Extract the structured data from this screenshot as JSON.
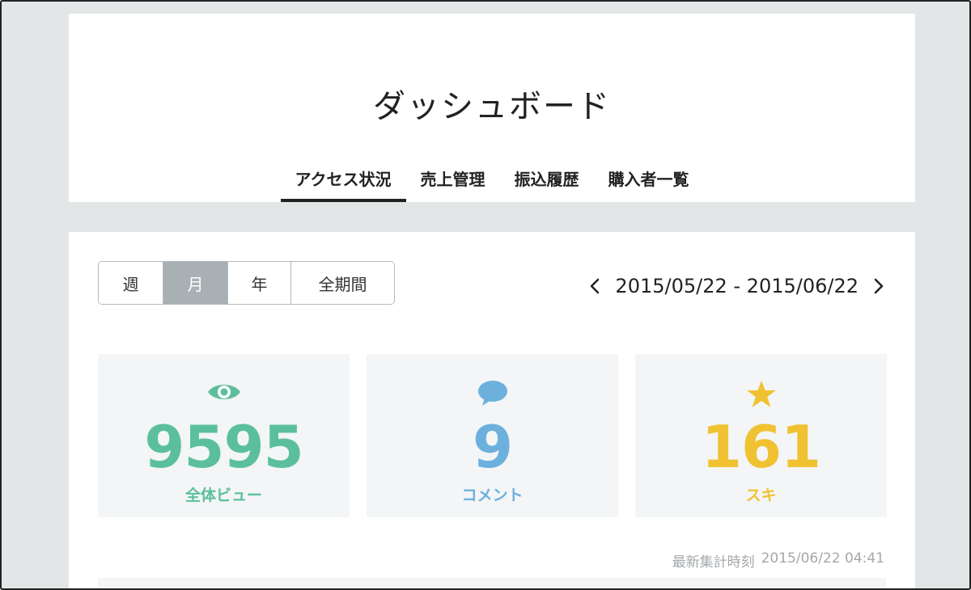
{
  "header": {
    "title": "ダッシュボード",
    "tabs": [
      {
        "label": "アクセス状況",
        "active": true
      },
      {
        "label": "売上管理",
        "active": false
      },
      {
        "label": "振込履歴",
        "active": false
      },
      {
        "label": "購入者一覧",
        "active": false
      }
    ]
  },
  "period": {
    "options": [
      "週",
      "月",
      "年",
      "全期間"
    ],
    "selected": "月"
  },
  "date_range": {
    "text": "2015/05/22 - 2015/06/22",
    "prev_icon": "chevron-left-icon",
    "next_icon": "chevron-right-icon"
  },
  "stats": [
    {
      "icon": "eye-icon",
      "value": "9595",
      "label": "全体ビュー",
      "color": "#5bbf9d"
    },
    {
      "icon": "comment-icon",
      "value": "9",
      "label": "コメント",
      "color": "#6cb0de"
    },
    {
      "icon": "star-icon",
      "value": "161",
      "label": "スキ",
      "color": "#f0c232"
    }
  ],
  "updated": {
    "label": "最新集計時刻",
    "timestamp": "2015/06/22 04:41"
  },
  "colors": {
    "background": "#e3e6e7",
    "selected_period": "#a9b0b4",
    "stat_bg": "#f3f5f6"
  }
}
